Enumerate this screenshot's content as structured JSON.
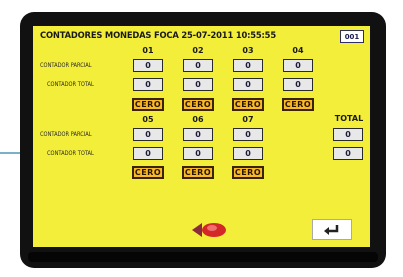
{
  "title": "CONTADORES MONEDAS FOCA 25-07-2011 10:55:55",
  "page_label": "001",
  "groups": [
    {
      "headers": [
        "01",
        "02",
        "03",
        "04"
      ],
      "row_labels": [
        "CONTADOR PARCIAL",
        "CONTADOR TOTAL"
      ],
      "partial": [
        "0",
        "0",
        "0",
        "0"
      ],
      "total": [
        "0",
        "0",
        "0",
        "0"
      ],
      "zero_labels": [
        "CERO",
        "CERO",
        "CERO",
        "CERO"
      ]
    },
    {
      "headers": [
        "05",
        "06",
        "07"
      ],
      "row_labels": [
        "CONTADOR PARCIAL",
        "CONTADOR TOTAL"
      ],
      "partial": [
        "0",
        "0",
        "0"
      ],
      "total": [
        "0",
        "0",
        "0"
      ],
      "zero_labels": [
        "CERO",
        "CERO",
        "CERO"
      ]
    }
  ],
  "totals": {
    "label": "TOTAL",
    "partial": "0",
    "total": "0"
  },
  "icons": {
    "nav": "arrow-left-icon",
    "back": "return-icon"
  },
  "colors": {
    "screen_bg": "#f3ee3a",
    "zero_button": "#f8b928",
    "bezel": "#111111"
  }
}
